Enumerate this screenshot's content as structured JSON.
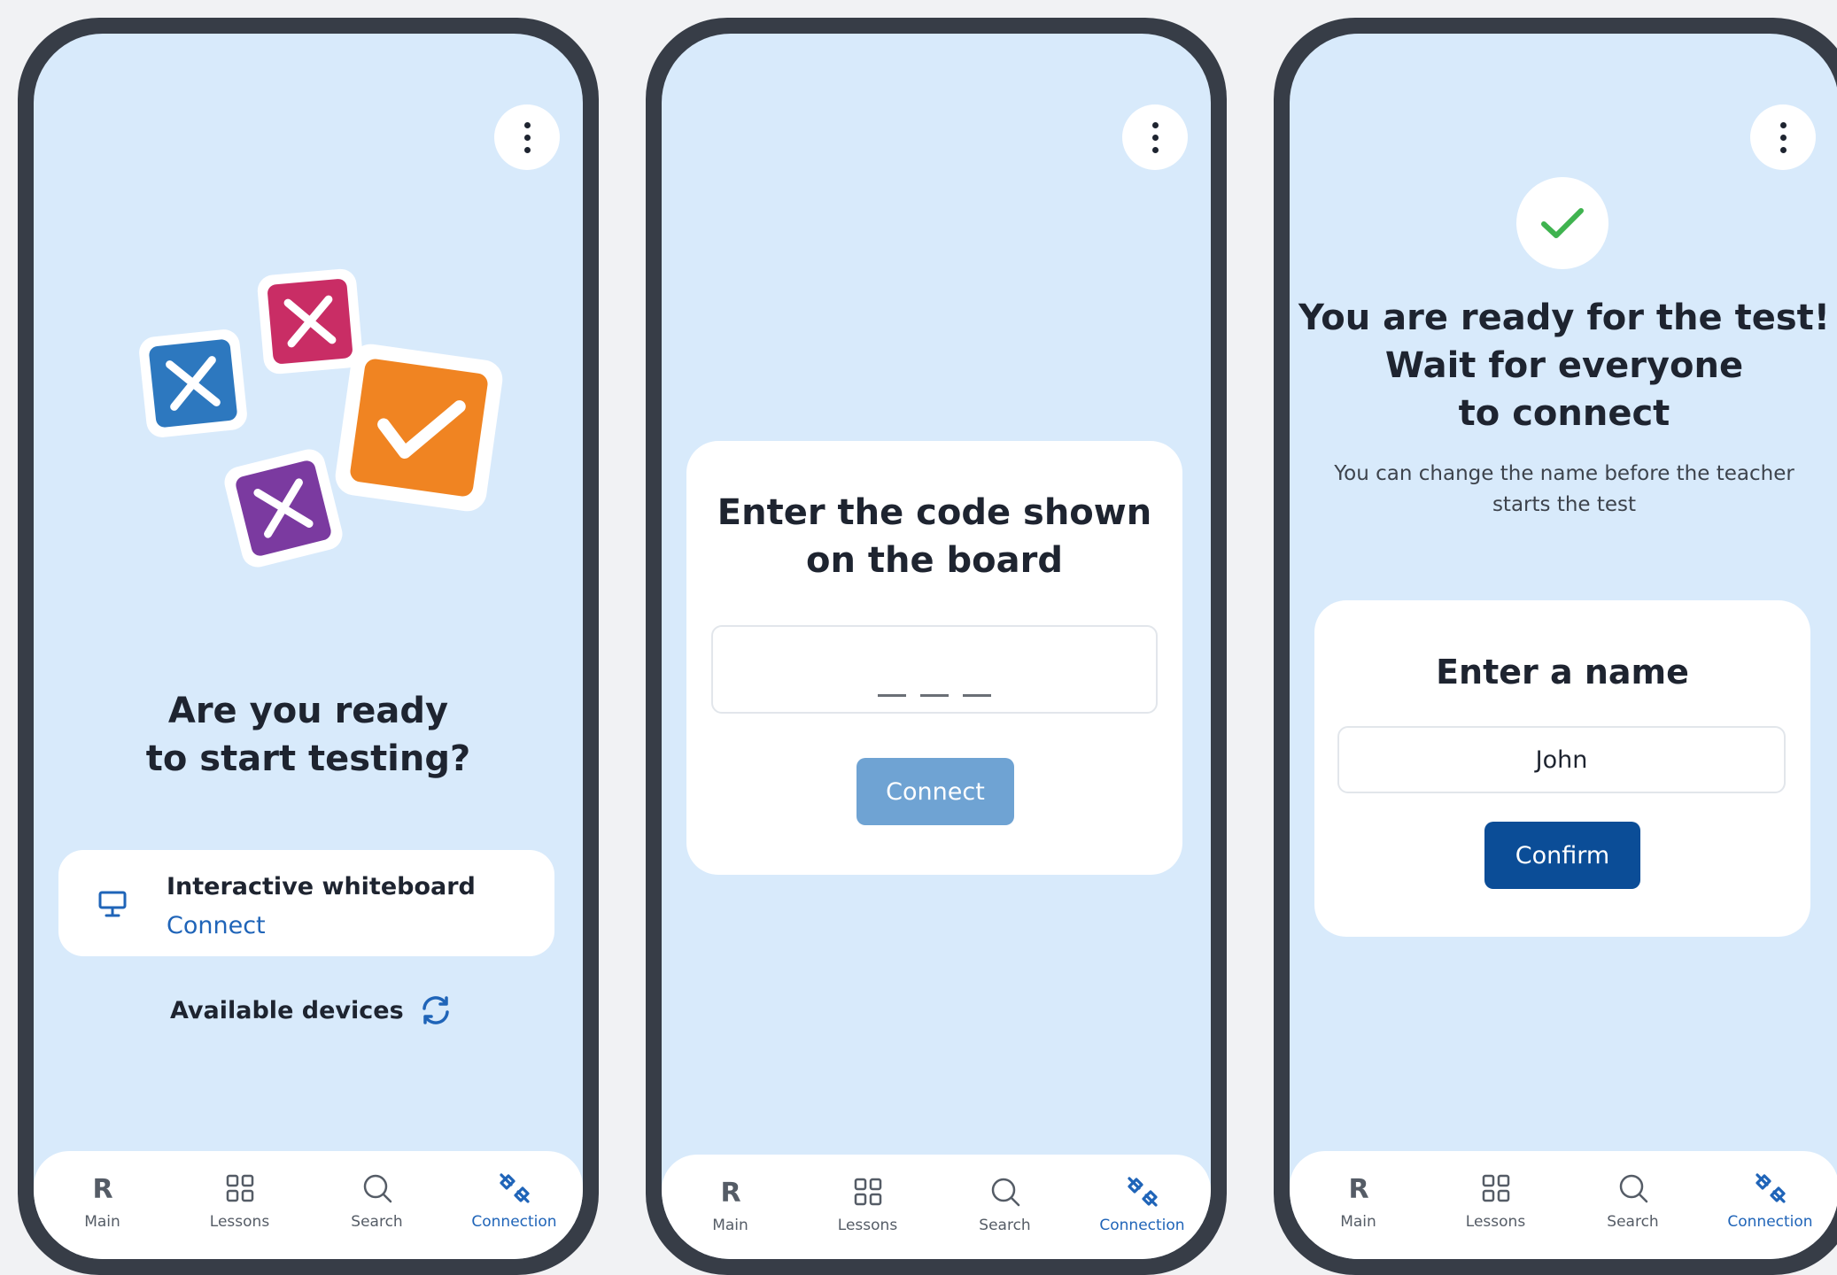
{
  "screens": [
    {
      "menu_icon": "more-vertical-icon",
      "illustration_icons": [
        "close-box-icon-blue",
        "close-box-icon-magenta",
        "close-box-icon-purple",
        "check-box-icon-orange"
      ],
      "title_line1": "Are you ready",
      "title_line2": "to start testing?",
      "whiteboard": {
        "icon": "monitor-icon",
        "title": "Interactive whiteboard",
        "link": "Connect"
      },
      "devices_label": "Available devices",
      "devices_icon": "refresh-icon"
    },
    {
      "menu_icon": "more-vertical-icon",
      "title_line1": "Enter the code shown",
      "title_line2": "on the board",
      "code_value": "",
      "connect_label": "Connect"
    },
    {
      "menu_icon": "more-vertical-icon",
      "status_icon": "check-icon",
      "title_line1": "You are ready for the test!",
      "title_line2": "Wait for everyone",
      "title_line3": "to connect",
      "subtitle_line1": "You can change the name before the teacher",
      "subtitle_line2": "starts the test",
      "name_title": "Enter a name",
      "name_value": "John",
      "confirm_label": "Confirm"
    }
  ],
  "tabbar": {
    "tabs": [
      {
        "label": "Main",
        "icon": "r-logo-icon",
        "active": false
      },
      {
        "label": "Lessons",
        "icon": "grid-icon",
        "active": false
      },
      {
        "label": "Search",
        "icon": "search-icon",
        "active": false
      },
      {
        "label": "Connection",
        "icon": "connection-icon",
        "active": true
      }
    ]
  },
  "colors": {
    "screen_bg": "#d8eafb",
    "phone_frame": "#373d47",
    "accent": "#1f64b8",
    "confirm_button": "#0b4d97",
    "connect_button_disabled": "#6fa3d3",
    "check_green": "#3fb34f",
    "illustration_blue": "#2d78bf",
    "illustration_magenta": "#c92d65",
    "illustration_purple": "#7b3aa0",
    "illustration_orange": "#f08422"
  }
}
